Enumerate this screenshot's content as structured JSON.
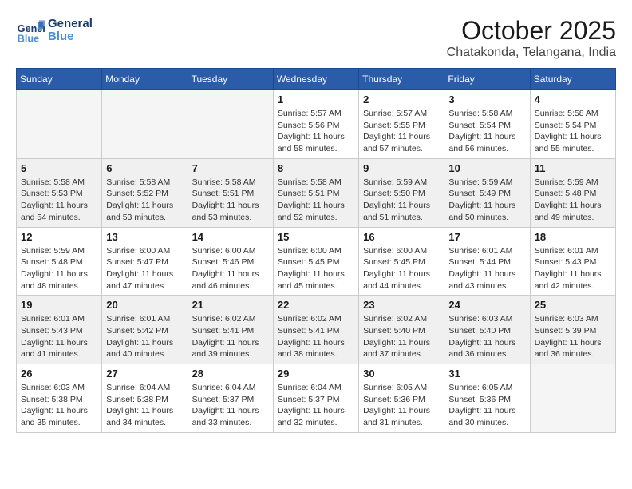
{
  "logo": {
    "line1": "General",
    "line2": "Blue"
  },
  "title": "October 2025",
  "subtitle": "Chatakonda, Telangana, India",
  "weekdays": [
    "Sunday",
    "Monday",
    "Tuesday",
    "Wednesday",
    "Thursday",
    "Friday",
    "Saturday"
  ],
  "weeks": [
    [
      {
        "day": "",
        "info": ""
      },
      {
        "day": "",
        "info": ""
      },
      {
        "day": "",
        "info": ""
      },
      {
        "day": "1",
        "info": "Sunrise: 5:57 AM\nSunset: 5:56 PM\nDaylight: 11 hours\nand 58 minutes."
      },
      {
        "day": "2",
        "info": "Sunrise: 5:57 AM\nSunset: 5:55 PM\nDaylight: 11 hours\nand 57 minutes."
      },
      {
        "day": "3",
        "info": "Sunrise: 5:58 AM\nSunset: 5:54 PM\nDaylight: 11 hours\nand 56 minutes."
      },
      {
        "day": "4",
        "info": "Sunrise: 5:58 AM\nSunset: 5:54 PM\nDaylight: 11 hours\nand 55 minutes."
      }
    ],
    [
      {
        "day": "5",
        "info": "Sunrise: 5:58 AM\nSunset: 5:53 PM\nDaylight: 11 hours\nand 54 minutes."
      },
      {
        "day": "6",
        "info": "Sunrise: 5:58 AM\nSunset: 5:52 PM\nDaylight: 11 hours\nand 53 minutes."
      },
      {
        "day": "7",
        "info": "Sunrise: 5:58 AM\nSunset: 5:51 PM\nDaylight: 11 hours\nand 53 minutes."
      },
      {
        "day": "8",
        "info": "Sunrise: 5:58 AM\nSunset: 5:51 PM\nDaylight: 11 hours\nand 52 minutes."
      },
      {
        "day": "9",
        "info": "Sunrise: 5:59 AM\nSunset: 5:50 PM\nDaylight: 11 hours\nand 51 minutes."
      },
      {
        "day": "10",
        "info": "Sunrise: 5:59 AM\nSunset: 5:49 PM\nDaylight: 11 hours\nand 50 minutes."
      },
      {
        "day": "11",
        "info": "Sunrise: 5:59 AM\nSunset: 5:48 PM\nDaylight: 11 hours\nand 49 minutes."
      }
    ],
    [
      {
        "day": "12",
        "info": "Sunrise: 5:59 AM\nSunset: 5:48 PM\nDaylight: 11 hours\nand 48 minutes."
      },
      {
        "day": "13",
        "info": "Sunrise: 6:00 AM\nSunset: 5:47 PM\nDaylight: 11 hours\nand 47 minutes."
      },
      {
        "day": "14",
        "info": "Sunrise: 6:00 AM\nSunset: 5:46 PM\nDaylight: 11 hours\nand 46 minutes."
      },
      {
        "day": "15",
        "info": "Sunrise: 6:00 AM\nSunset: 5:45 PM\nDaylight: 11 hours\nand 45 minutes."
      },
      {
        "day": "16",
        "info": "Sunrise: 6:00 AM\nSunset: 5:45 PM\nDaylight: 11 hours\nand 44 minutes."
      },
      {
        "day": "17",
        "info": "Sunrise: 6:01 AM\nSunset: 5:44 PM\nDaylight: 11 hours\nand 43 minutes."
      },
      {
        "day": "18",
        "info": "Sunrise: 6:01 AM\nSunset: 5:43 PM\nDaylight: 11 hours\nand 42 minutes."
      }
    ],
    [
      {
        "day": "19",
        "info": "Sunrise: 6:01 AM\nSunset: 5:43 PM\nDaylight: 11 hours\nand 41 minutes."
      },
      {
        "day": "20",
        "info": "Sunrise: 6:01 AM\nSunset: 5:42 PM\nDaylight: 11 hours\nand 40 minutes."
      },
      {
        "day": "21",
        "info": "Sunrise: 6:02 AM\nSunset: 5:41 PM\nDaylight: 11 hours\nand 39 minutes."
      },
      {
        "day": "22",
        "info": "Sunrise: 6:02 AM\nSunset: 5:41 PM\nDaylight: 11 hours\nand 38 minutes."
      },
      {
        "day": "23",
        "info": "Sunrise: 6:02 AM\nSunset: 5:40 PM\nDaylight: 11 hours\nand 37 minutes."
      },
      {
        "day": "24",
        "info": "Sunrise: 6:03 AM\nSunset: 5:40 PM\nDaylight: 11 hours\nand 36 minutes."
      },
      {
        "day": "25",
        "info": "Sunrise: 6:03 AM\nSunset: 5:39 PM\nDaylight: 11 hours\nand 36 minutes."
      }
    ],
    [
      {
        "day": "26",
        "info": "Sunrise: 6:03 AM\nSunset: 5:38 PM\nDaylight: 11 hours\nand 35 minutes."
      },
      {
        "day": "27",
        "info": "Sunrise: 6:04 AM\nSunset: 5:38 PM\nDaylight: 11 hours\nand 34 minutes."
      },
      {
        "day": "28",
        "info": "Sunrise: 6:04 AM\nSunset: 5:37 PM\nDaylight: 11 hours\nand 33 minutes."
      },
      {
        "day": "29",
        "info": "Sunrise: 6:04 AM\nSunset: 5:37 PM\nDaylight: 11 hours\nand 32 minutes."
      },
      {
        "day": "30",
        "info": "Sunrise: 6:05 AM\nSunset: 5:36 PM\nDaylight: 11 hours\nand 31 minutes."
      },
      {
        "day": "31",
        "info": "Sunrise: 6:05 AM\nSunset: 5:36 PM\nDaylight: 11 hours\nand 30 minutes."
      },
      {
        "day": "",
        "info": ""
      }
    ]
  ]
}
